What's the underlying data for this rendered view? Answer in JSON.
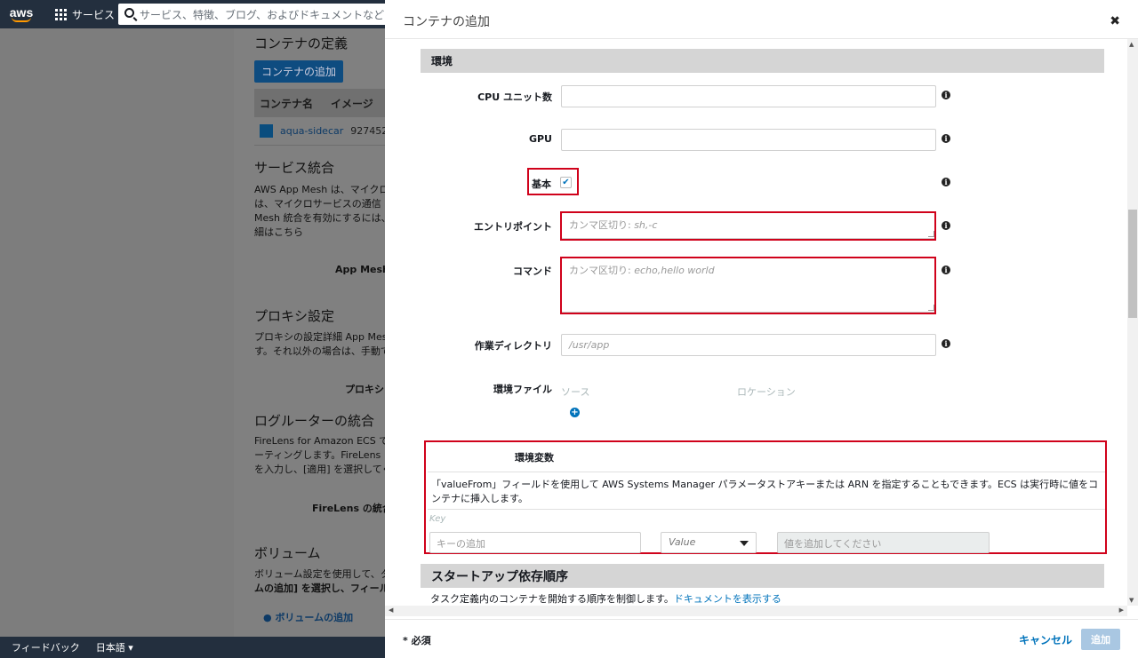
{
  "topnav": {
    "logo": "aws",
    "services_label": "サービス",
    "search_placeholder": "サービス、特徴、ブログ、およびドキュメントなどを検"
  },
  "background": {
    "container_def_title": "コンテナの定義",
    "add_container_btn": "コンテナの追加",
    "table_headers": [
      "コンテナ名",
      "イメージ"
    ],
    "row_name": "aqua-sidecar",
    "row_image": "927452",
    "service_integration_title": "サービス統合",
    "service_integration_lines": [
      "AWS App Mesh は、マイクロ",
      "は、マイクロサービスの通信",
      "Mesh 統合を有効にするには、"
    ],
    "service_integration_link": "細はこちら",
    "app_mesh_label": "App Mesh",
    "proxy_title": "プロキシ設定",
    "proxy_lines": [
      "プロキシの設定詳細 App Mesh",
      "す。それ以外の場合は、手動で"
    ],
    "proxy_label": "プロキシ",
    "log_router_title": "ログルーターの統合",
    "log_router_lines": [
      "FireLens for Amazon ECS では",
      "ーティングします。FireLens",
      "を入力し、[適用] を選択してく"
    ],
    "firelens_label": "FireLens の統合",
    "volume_title": "ボリューム",
    "volume_lines": [
      "ボリューム設定を使用して、タ",
      "ムの追加] を選択し、フィール"
    ],
    "add_volume_link": "ボリュームの追加"
  },
  "footer": {
    "feedback": "フィードバック",
    "language": "日本語 ▾"
  },
  "modal": {
    "title": "コンテナの追加",
    "close": "✖",
    "section_env": "環境",
    "fields": {
      "cpu_label": "CPU ユニット数",
      "gpu_label": "GPU",
      "essential_label": "基本",
      "essential_checked": true,
      "entrypoint_label": "エントリポイント",
      "entrypoint_placeholder_ja": "カンマ区切り: ",
      "entrypoint_placeholder_ex": "sh,-c",
      "command_label": "コマンド",
      "command_placeholder_ja": "カンマ区切り: ",
      "command_placeholder_ex": "echo,hello world",
      "workdir_label": "作業ディレクトリ",
      "workdir_placeholder": "/usr/app",
      "envfile_label": "環境ファイル",
      "envfile_source": "ソース",
      "envfile_location": "ロケーション"
    },
    "env_vars": {
      "title": "環境変数",
      "description": "「valueFrom」フィールドを使用して AWS Systems Manager パラメータストアキーまたは ARN を指定することもできます。ECS は実行時に値をコンテナに挿入します。",
      "key_header": "Key",
      "key_placeholder": "キーの追加",
      "type_value": "Value",
      "value_placeholder": "値を追加してください"
    },
    "startup": {
      "title": "スタートアップ依存順序",
      "description": "タスク定義内のコンテナを開始する順序を制御します。",
      "doc_link": "ドキュメントを表示する"
    },
    "required_note": "* 必須",
    "cancel": "キャンセル",
    "add": "追加"
  },
  "colors": {
    "highlight_red": "#d0021b",
    "link_blue": "#0073bb",
    "nav_dark": "#232f3e"
  }
}
